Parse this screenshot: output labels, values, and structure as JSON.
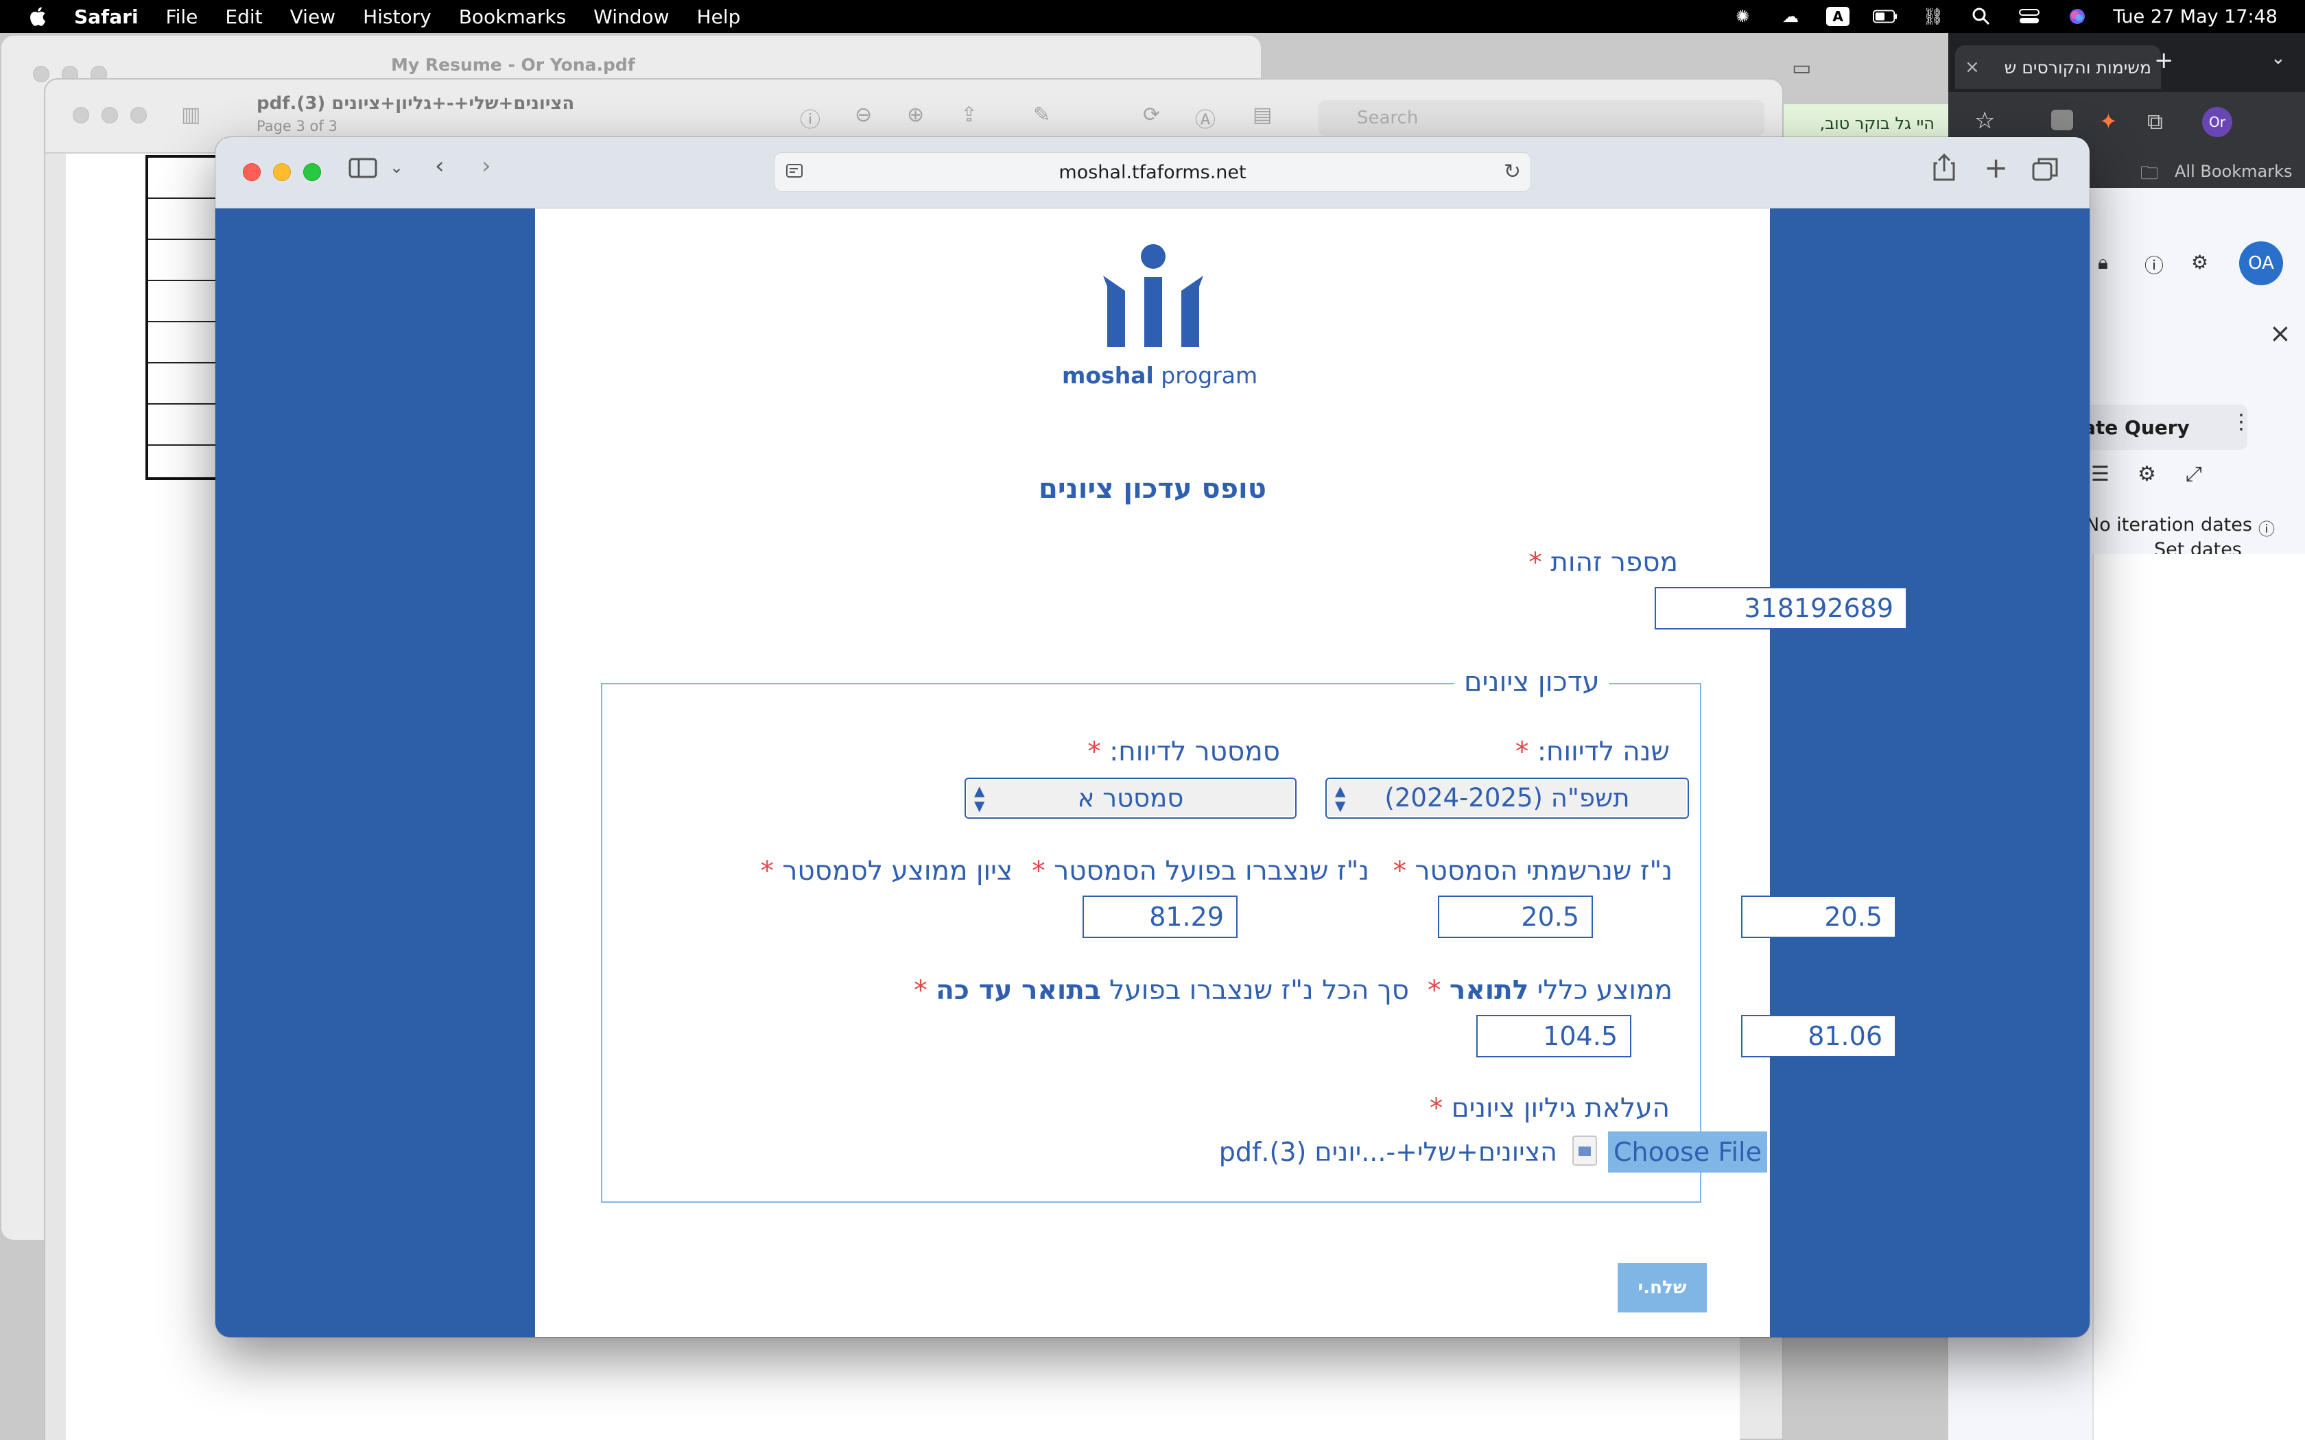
{
  "menubar": {
    "app_name": "Safari",
    "items": [
      "File",
      "Edit",
      "View",
      "History",
      "Bookmarks",
      "Window",
      "Help"
    ],
    "input_source": "A",
    "clock": "Tue 27 May  17:48"
  },
  "pdf_back": {
    "title": "My Resume - Or Yona.pdf"
  },
  "pdf_window": {
    "title": "הציונים+שלי+-+גליון+ציונים (3).pdf",
    "subtitle": "Page 3 of 3",
    "search_placeholder": "Search"
  },
  "chrome": {
    "tab_title": "משימות והקורסים ש",
    "tab_close": "×",
    "new_tab": "+",
    "bookmarks_label": "All Bookmarks",
    "avatar_small": "Or",
    "avatar": "OA",
    "banner_text": "היי גל בוקר טוב,",
    "query_button": "ate Query",
    "iteration_text": "No iteration dates",
    "set_dates": "Set dates"
  },
  "safari": {
    "url": "moshal.tfaforms.net"
  },
  "form": {
    "logo_brand": "moshal",
    "logo_suffix": " program",
    "title": "טופס עדכון ציונים",
    "id_label": "מספר זהות",
    "id_value": "318192689",
    "fieldset_legend": "עדכון ציונים",
    "year_label": "שנה לדיווח:",
    "year_value": "תשפ\"ה (2024-2025)",
    "semester_label": "סמסטר לדיווח:",
    "semester_value": "סמסטר א",
    "registered_credits_label": "נ\"ז שנרשמתי הסמסטר",
    "registered_credits_value": "20.5",
    "earned_credits_label": "נ\"ז שנצברו בפועל הסמסטר",
    "earned_credits_value": "20.5",
    "semester_avg_label": "ציון ממוצע לסמסטר",
    "semester_avg_value": "81.29",
    "degree_avg_label_pre": "ממוצע כללי ",
    "degree_avg_label_bold": "לתואר",
    "degree_avg_value": "81.06",
    "total_credits_label_pre": "סך הכל נ\"ז שנצברו בפועל ",
    "total_credits_label_bold": "בתואר עד כה",
    "total_credits_value": "104.5",
    "upload_label": "העלאת גיליון ציונים",
    "choose_file": "Choose File",
    "file_name": "הציונים+שלי+-...יונים (3).pdf",
    "required_mark": "*",
    "submit": "שלח.י"
  },
  "colors": {
    "brand_blue": "#2f5fb0",
    "page_blue": "#2d5fa8",
    "required_red": "#e04848",
    "light_blue": "#7fb6e6"
  }
}
